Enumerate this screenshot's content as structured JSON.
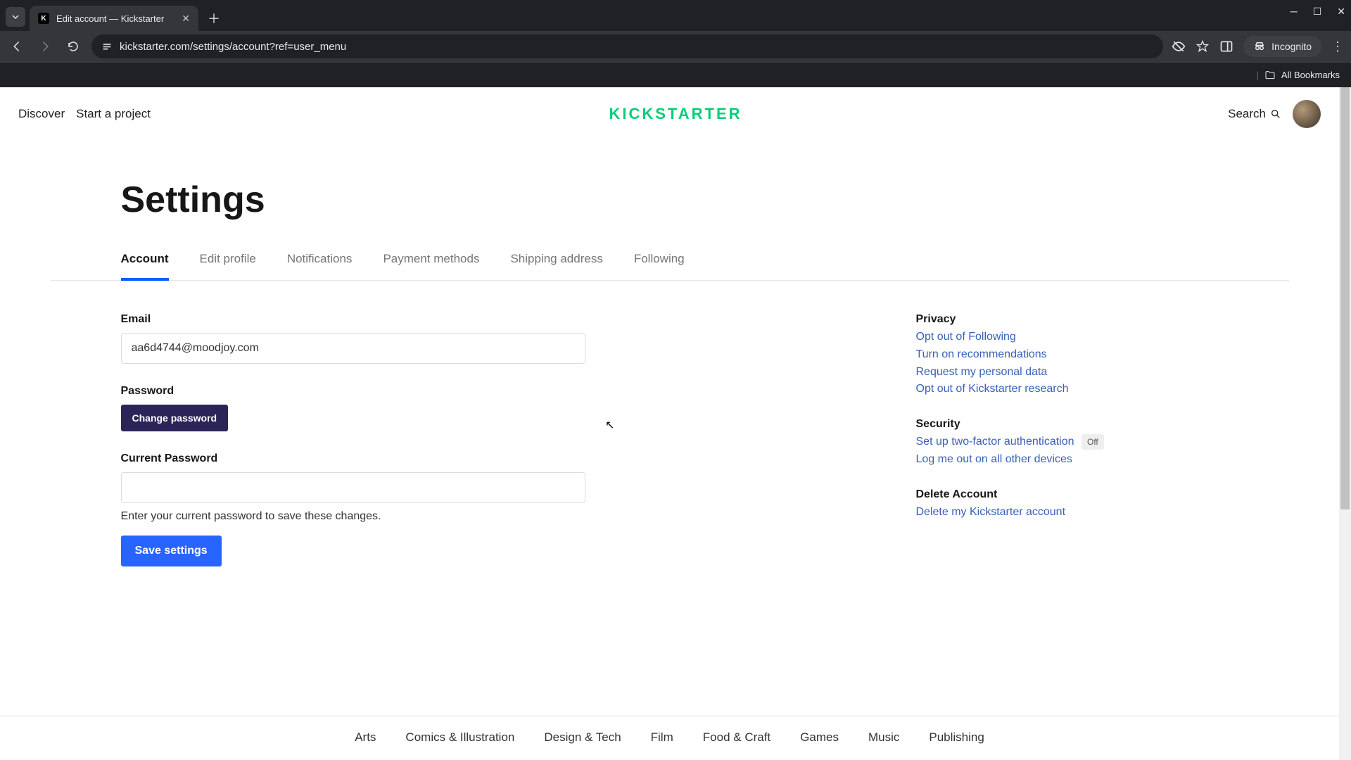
{
  "browser": {
    "tab_title": "Edit account — Kickstarter",
    "url": "kickstarter.com/settings/account?ref=user_menu",
    "incognito_label": "Incognito",
    "bookmarks_label": "All Bookmarks"
  },
  "header": {
    "discover": "Discover",
    "start": "Start a project",
    "brand": "KICKSTARTER",
    "search": "Search"
  },
  "page": {
    "title": "Settings",
    "tabs": [
      "Account",
      "Edit profile",
      "Notifications",
      "Payment methods",
      "Shipping address",
      "Following"
    ],
    "active_tab_index": 0
  },
  "form": {
    "email_label": "Email",
    "email_value": "aa6d4744@moodjoy.com",
    "password_label": "Password",
    "change_password": "Change password",
    "current_password_label": "Current Password",
    "current_password_value": "",
    "current_password_help": "Enter your current password to save these changes.",
    "save": "Save settings"
  },
  "sidebar": {
    "privacy": {
      "heading": "Privacy",
      "links": [
        "Opt out of Following",
        "Turn on recommendations",
        "Request my personal data",
        "Opt out of Kickstarter research"
      ]
    },
    "security": {
      "heading": "Security",
      "twofa": "Set up two-factor authentication",
      "twofa_badge": "Off",
      "logout_all": "Log me out on all other devices"
    },
    "delete": {
      "heading": "Delete Account",
      "link": "Delete my Kickstarter account"
    }
  },
  "footer": {
    "categories": [
      "Arts",
      "Comics & Illustration",
      "Design & Tech",
      "Film",
      "Food & Craft",
      "Games",
      "Music",
      "Publishing"
    ]
  }
}
